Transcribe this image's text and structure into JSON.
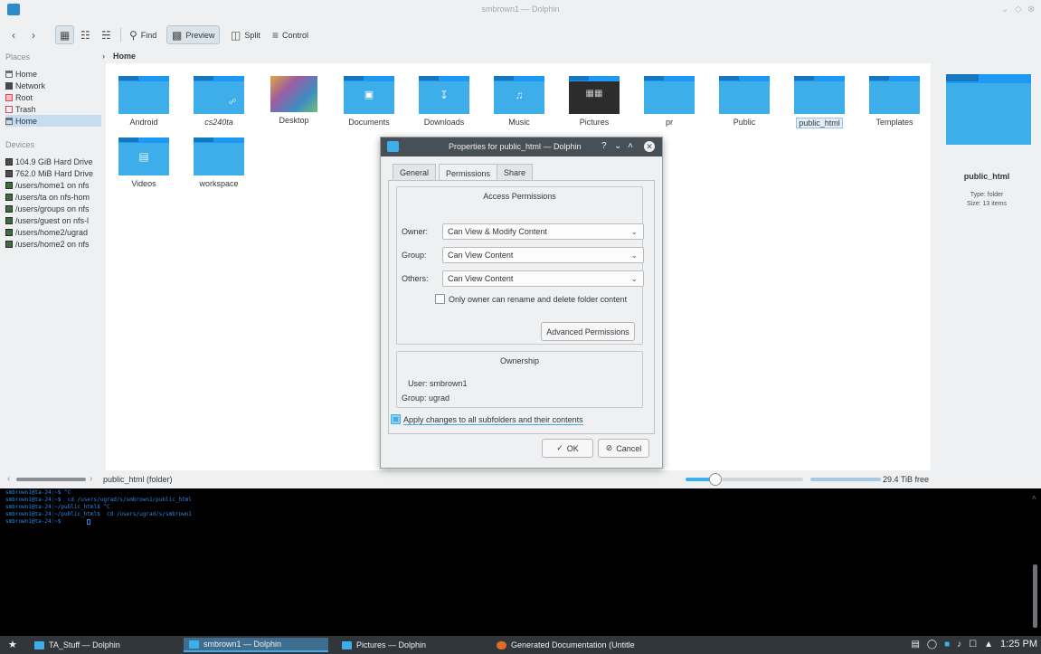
{
  "window": {
    "title": "smbrown1 — Dolphin"
  },
  "toolbar": {
    "back_icon": "back-arrow-icon",
    "forward_icon": "forward-arrow-icon",
    "find": "Find",
    "preview": "Preview",
    "split": "Split",
    "control": "Control"
  },
  "places": {
    "places_header": "Places",
    "items": [
      "Home",
      "Network",
      "Root",
      "Trash",
      "Home"
    ],
    "devices_header": "Devices",
    "devices": [
      "104.9 GiB Hard Drive",
      "762.0 MiB Hard Drive",
      "/users/home1 on nfs",
      "/users/ta on nfs-hom",
      "/users/groups on nfs",
      "/users/guest on nfs-l",
      "/users/home2/ugrad",
      "/users/home2 on nfs"
    ]
  },
  "breadcrumb": {
    "current": "Home"
  },
  "files": [
    {
      "name": "Android",
      "icon": "folder-icon"
    },
    {
      "name": "cs240ta",
      "icon": "folder-link-icon"
    },
    {
      "name": "Desktop",
      "icon": "desktop-thumbnail"
    },
    {
      "name": "Documents",
      "icon": "folder-documents-icon"
    },
    {
      "name": "Downloads",
      "icon": "folder-downloads-icon"
    },
    {
      "name": "Music",
      "icon": "folder-music-icon"
    },
    {
      "name": "Pictures",
      "icon": "folder-pictures-icon"
    },
    {
      "name": "pr",
      "icon": "folder-icon"
    },
    {
      "name": "Public",
      "icon": "folder-icon"
    },
    {
      "name": "public_html",
      "icon": "folder-icon"
    },
    {
      "name": "Templates",
      "icon": "folder-icon"
    },
    {
      "name": "Videos",
      "icon": "folder-videos-icon"
    },
    {
      "name": "workspace",
      "icon": "folder-icon"
    }
  ],
  "info_panel": {
    "name": "public_html",
    "type": "Type: folder",
    "size": "Size: 13 items"
  },
  "statusbar": {
    "path": "public_html (folder)",
    "free": "29.4 TiB free"
  },
  "terminal": {
    "lines": [
      "smbrown1@ta-24:~$ ^C",
      "smbrown1@ta-24:~$  cd /users/ugrad/s/smbrown1/public_html",
      "smbrown1@ta-24:~/public_html$ ^C",
      "smbrown1@ta-24:~/public_html$  cd /users/ugrad/s/smbrown1",
      "smbrown1@ta-24:~$ "
    ]
  },
  "dialog": {
    "title": "Properties for public_html — Dolphin",
    "tabs": [
      "General",
      "Permissions",
      "Share"
    ],
    "access_title": "Access Permissions",
    "owner_label": "Owner:",
    "owner_value": "Can View & Modify Content",
    "group_label": "Group:",
    "group_value": "Can View Content",
    "others_label": "Others:",
    "others_value": "Can View Content",
    "only_owner": "Only owner can rename and delete folder content",
    "advanced": "Advanced Permissions",
    "ownership_title": "Ownership",
    "user_line": "User: smbrown1",
    "group_line": "Group: ugrad",
    "apply_all": "Apply changes to all subfolders and their contents",
    "ok": "OK",
    "cancel": "Cancel"
  },
  "taskbar": {
    "tasks": [
      "TA_Stuff — Dolphin",
      "smbrown1 — Dolphin",
      "Pictures — Dolphin",
      "Generated Documentation (Untitle"
    ],
    "clock": "1:25 PM"
  },
  "colors": {
    "accent": "#3daee9",
    "folder": "#1d99f3",
    "terminal_bg": "#000000",
    "terminal_text": "#2f86e0"
  }
}
